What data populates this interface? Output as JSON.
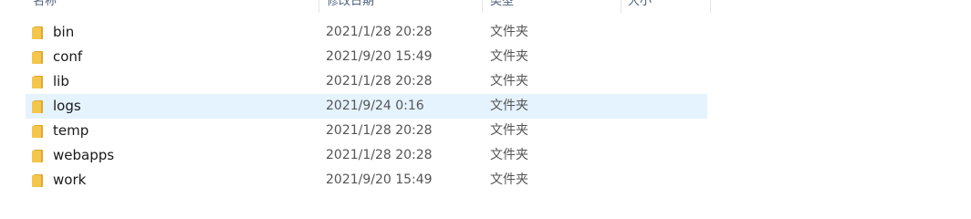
{
  "columns": [
    {
      "label": "名称"
    },
    {
      "label": "修改日期"
    },
    {
      "label": "类型"
    },
    {
      "label": "大小"
    }
  ],
  "rows": [
    {
      "name": "bin",
      "date": "2021/1/28 20:28",
      "type": "文件夹",
      "selected": false
    },
    {
      "name": "conf",
      "date": "2021/9/20 15:49",
      "type": "文件夹",
      "selected": false
    },
    {
      "name": "lib",
      "date": "2021/1/28 20:28",
      "type": "文件夹",
      "selected": false
    },
    {
      "name": "logs",
      "date": "2021/9/24 0:16",
      "type": "文件夹",
      "selected": true
    },
    {
      "name": "temp",
      "date": "2021/1/28 20:28",
      "type": "文件夹",
      "selected": false
    },
    {
      "name": "webapps",
      "date": "2021/1/28 20:28",
      "type": "文件夹",
      "selected": false
    },
    {
      "name": "work",
      "date": "2021/9/20 15:49",
      "type": "文件夹",
      "selected": false
    }
  ],
  "colors": {
    "selection": "#e5f3ff",
    "folder": "#f4c64b",
    "folder_dark": "#dca932",
    "header_text": "#4c607a"
  },
  "icons": {
    "row_icon": "folder-icon"
  }
}
